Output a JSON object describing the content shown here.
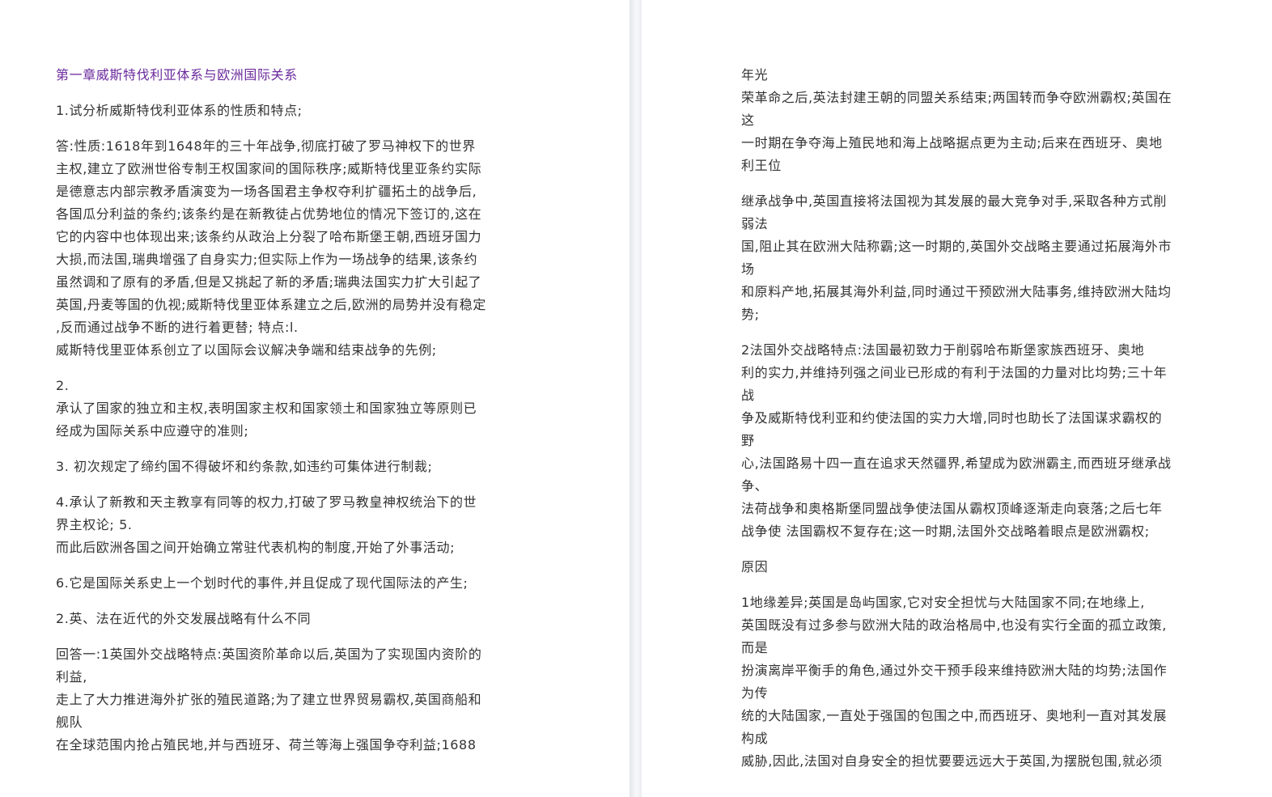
{
  "document": {
    "left_page": {
      "chapter_title": "第一章威斯特伐利亚体系与欧洲国际关系",
      "paragraphs": [
        [
          "1.试分析威斯特伐利亚体系的性质和特点;"
        ],
        [
          "答:性质:1618年到1648年的三十年战争,彻底打破了罗马神权下的世界",
          "主权,建立了欧洲世俗专制王权国家间的国际秩序;威斯特伐里亚条约实际",
          "是德意志内部宗教矛盾演变为一场各国君主争权夺利扩疆拓土的战争后,",
          "各国瓜分利益的条约;该条约是在新教徒占优势地位的情况下签订的,这在",
          "它的内容中也体现出来;该条约从政治上分裂了哈布斯堡王朝,西班牙国力",
          "大损,而法国,瑞典增强了自身实力;但实际上作为一场战争的结果,该条约",
          "虽然调和了原有的矛盾,但是又挑起了新的矛盾;瑞典法国实力扩大引起了",
          "英国,丹麦等国的仇视;威斯特伐里亚体系建立之后,欧洲的局势并没有稳定",
          ",反而通过战争不断的进行着更替; 特点:l.",
          "威斯特伐里亚体系创立了以国际会议解决争端和结束战争的先例;"
        ],
        [
          "2.",
          "承认了国家的独立和主权,表明国家主权和国家领土和国家独立等原则已",
          "经成为国际关系中应遵守的准则;"
        ],
        [
          "3. 初次规定了缔约国不得破坏和约条款,如违约可集体进行制裁;"
        ],
        [
          "4.承认了新教和天主教享有同等的权力,打破了罗马教皇神权统治下的世",
          "界主权论; 5.",
          "而此后欧洲各国之间开始确立常驻代表机构的制度,开始了外事活动;"
        ],
        [
          "6.它是国际关系史上一个划时代的事件,并且促成了现代国际法的产生;"
        ],
        [
          "2.英、法在近代的外交发展战略有什么不同"
        ],
        [
          "回答一:1英国外交战略特点:英国资阶革命以后,英国为了实现国内资阶的",
          "利益,",
          "走上了大力推进海外扩张的殖民道路;为了建立世界贸易霸权,英国商船和",
          "舰队",
          "在全球范围内抢占殖民地,并与西班牙、荷兰等海上强国争夺利益;1688"
        ]
      ]
    },
    "right_page": {
      "paragraphs": [
        [
          "年光",
          "荣革命之后,英法封建王朝的同盟关系结束;两国转而争夺欧洲霸权;英国在",
          "这",
          "一时期在争夺海上殖民地和海上战略据点更为主动;后来在西班牙、奥地",
          "利王位"
        ],
        [
          "继承战争中,英国直接将法国视为其发展的最大竞争对手,采取各种方式削",
          "弱法",
          "国,阻止其在欧洲大陆称霸;这一时期的,英国外交战略主要通过拓展海外市",
          "场",
          "和原料产地,拓展其海外利益,同时通过干预欧洲大陆事务,维持欧洲大陆均",
          "势;"
        ],
        [
          "2法国外交战略特点:法国最初致力于削弱哈布斯堡家族西班牙、奥地",
          "利的实力,并维持列强之间业已形成的有利于法国的力量对比均势;三十年",
          "战",
          "争及威斯特伐利亚和约使法国的实力大增,同时也助长了法国谋求霸权的",
          "野",
          "心,法国路易十四一直在追求天然疆界,希望成为欧洲霸主,而西班牙继承战",
          "争、",
          "法荷战争和奥格斯堡同盟战争使法国从霸权顶峰逐渐走向衰落;之后七年",
          "战争使 法国霸权不复存在;这一时期,法国外交战略着眼点是欧洲霸权;"
        ],
        [
          "原因"
        ],
        [
          "1地缘差异;英国是岛屿国家,它对安全担忧与大陆国家不同;在地缘上,",
          "英国既没有过多参与欧洲大陆的政治格局中,也没有实行全面的孤立政策,",
          "而是",
          "扮演离岸平衡手的角色,通过外交干预手段来维持欧洲大陆的均势;法国作",
          "为传",
          "统的大陆国家,一直处于强国的包围之中,而西班牙、奥地利一直对其发展",
          "构成",
          "威胁,因此,法国对自身安全的担忧要要远远大于英国,为摆脱包围,就必须"
        ]
      ]
    },
    "colors": {
      "title": "#6a2a9c",
      "body_text": "#333333",
      "background": "#ffffff",
      "gutter": "#eceef1"
    }
  }
}
